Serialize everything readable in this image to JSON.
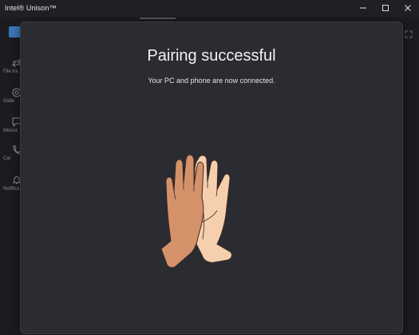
{
  "window": {
    "title": "Intel® Unison™",
    "controls": [
      "minimize-icon",
      "maximize-icon",
      "close-icon"
    ]
  },
  "background_app": {
    "nav_items": [
      {
        "label": "File tra",
        "icon": "file-transfer-icon"
      },
      {
        "label": "Galle",
        "icon": "gallery-icon"
      },
      {
        "label": "Messa",
        "icon": "messages-icon"
      },
      {
        "label": "Cal",
        "icon": "calls-icon"
      },
      {
        "label": "Notifica",
        "icon": "notifications-icon"
      }
    ]
  },
  "dialog": {
    "title": "Pairing successful",
    "subtitle": "Your PC and phone are now connected.",
    "illustration": "high-five-hands-icon"
  },
  "colors": {
    "window_bg": "#1c1d21",
    "dialog_bg": "#2b2c31",
    "hand_left": "#d5926a",
    "hand_right": "#f6cfae",
    "accent": "#3a76b8"
  }
}
